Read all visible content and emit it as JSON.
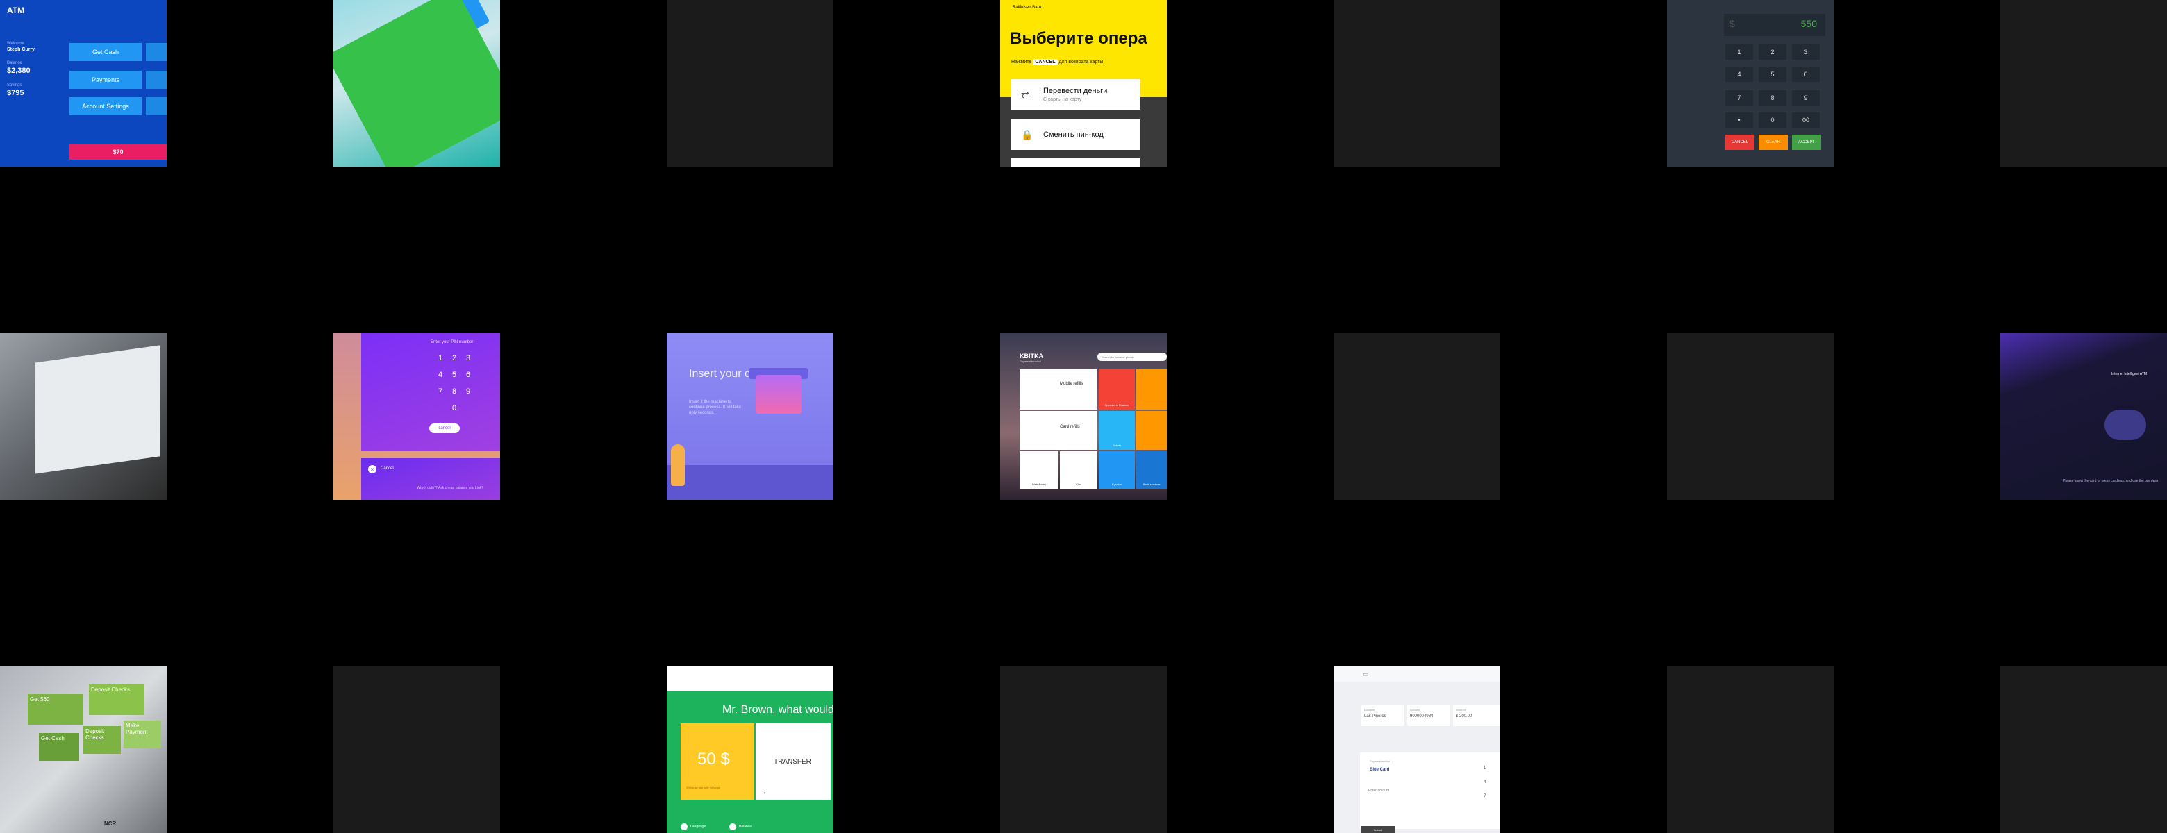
{
  "atm_blue": {
    "title": "ATM",
    "user_label": "Welcome",
    "user_name": "Steph Curry",
    "balance_label": "Balance",
    "balance": "$2,380",
    "savings_label": "Savings",
    "savings": "$795",
    "buttons": [
      "Get Cash",
      "Payments",
      "Account Settings"
    ],
    "bottom_amount": "$70"
  },
  "raiffeisen": {
    "bank": "Raiffeisen Bank",
    "heading": "Выберите опера",
    "hint_pre": "Нажмите",
    "hint_key": "CANCEL",
    "hint_post": "для возврата карты",
    "options": [
      {
        "title": "Перевести деньги",
        "subtitle": "С карты на карту"
      },
      {
        "title": "Сменить пин-код",
        "subtitle": ""
      }
    ]
  },
  "keypad": {
    "currency": "$",
    "amount": "550",
    "keys": [
      "1",
      "2",
      "3",
      "4",
      "5",
      "6",
      "7",
      "8",
      "9",
      "•",
      "0",
      "00"
    ],
    "actions": [
      {
        "label": "CANCEL",
        "color": "#e53935"
      },
      {
        "label": "CLEAR",
        "color": "#fb8c00"
      },
      {
        "label": "ACCEPT",
        "color": "#43a047"
      }
    ]
  },
  "pin": {
    "title": "Enter your PIN number",
    "keys": [
      "1",
      "2",
      "3",
      "4",
      "5",
      "6",
      "7",
      "8",
      "9",
      "0"
    ],
    "cancel": "cancel",
    "bottom_cancel": "Cancel",
    "bottom_question": "Why it didn't? Ask cheap balance you Link?"
  },
  "insert": {
    "title": "Insert your card",
    "desc": "Insert it the machine to continue process. It will take only seconds."
  },
  "kvitka": {
    "brand": "KBITKA",
    "sub": "Payment terminal",
    "search": "Search by name or phone",
    "cells": [
      {
        "label": "Mobile refills",
        "color": "#ffffff"
      },
      {
        "label": "Sports and Finance",
        "color": "#f44336"
      },
      {
        "label": "",
        "color": "#ff9800"
      },
      {
        "label": "Card refills",
        "color": "#ffffff"
      },
      {
        "label": "Tickets",
        "color": "#29b6f6"
      },
      {
        "label": "",
        "color": "#ff9800"
      },
      {
        "label": "WebMoney",
        "color": "#ffffff"
      },
      {
        "label": "Kiwi",
        "color": "#ffffff"
      },
      {
        "label": "Kyivstar",
        "color": "#2196f3"
      },
      {
        "label": "Bank services",
        "color": "#1976d2"
      }
    ]
  },
  "dark_atm": {
    "title": "Internet Intelligent ATM",
    "footer": "Please insert the card or press cardless, and use the our dwar"
  },
  "ncr": {
    "tiles": [
      {
        "label": "Get $60",
        "color": "#7cb342"
      },
      {
        "label": "Deposit Checks",
        "color": "#8bc34a"
      },
      {
        "label": "Get Cash",
        "color": "#689f38"
      },
      {
        "label": "Deposit Checks",
        "color": "#7cb342"
      },
      {
        "label": "Make Payment",
        "color": "#9ccc65"
      }
    ],
    "logo": "NCR"
  },
  "brown": {
    "heading": "Mr. Brown, what would",
    "yellow_value": "50 $",
    "yellow_sub": "Withdraw fast with Nalvega",
    "white_value": "TRANSFER",
    "footer_left": "Language",
    "footer_right": "Balance"
  },
  "form": {
    "field1_label": "Location",
    "field1_value": "Las Piñeros",
    "field2_label": "Account",
    "field2_value": "9000004984",
    "field3_label": "Amount",
    "field3_value": "$ 200.00",
    "section_label": "Payment method",
    "pay_text": "Blue Card",
    "enter_label": "Enter amount",
    "numbers": [
      "1",
      "4",
      "7"
    ],
    "submit": "Submit"
  }
}
